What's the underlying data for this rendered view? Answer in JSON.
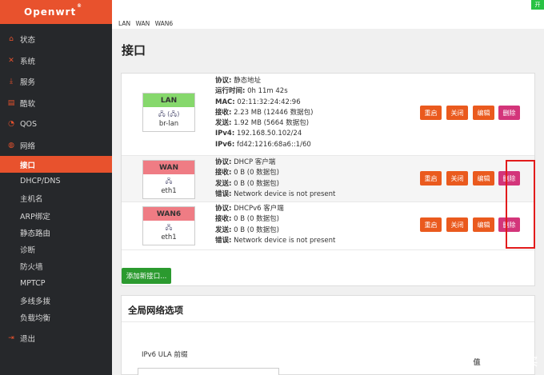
{
  "brand": {
    "name": "Openwrt",
    "reg": "®"
  },
  "topbar": {
    "toggle": "开"
  },
  "breadcrumb": [
    "LAN",
    "WAN",
    "WAN6"
  ],
  "sidebar": {
    "items": [
      {
        "icon": "home-icon",
        "glyph": "⌂",
        "label": "状态"
      },
      {
        "icon": "tools-icon",
        "glyph": "✕",
        "label": "系统"
      },
      {
        "icon": "download-icon",
        "glyph": "⤓",
        "label": "服务"
      },
      {
        "icon": "box-icon",
        "glyph": "▤",
        "label": "酷软"
      },
      {
        "icon": "gauge-icon",
        "glyph": "◔",
        "label": "QOS"
      },
      {
        "icon": "globe-icon",
        "glyph": "◍",
        "label": "网络"
      }
    ],
    "submenu": [
      "接口",
      "DHCP/DNS",
      "主机名",
      "ARP绑定",
      "静态路由",
      "诊断",
      "防火墙",
      "MPTCP",
      "多线多拨",
      "负载均衡"
    ],
    "logout": {
      "icon": "logout-icon",
      "glyph": "⇥",
      "label": "退出"
    }
  },
  "page": {
    "title": "接口"
  },
  "interfaces": [
    {
      "name": "LAN",
      "device": "br-lan",
      "dev_icons": "🖧 (🖧)",
      "info": [
        [
          "协议:",
          "静态地址"
        ],
        [
          "运行时间:",
          "0h 11m 42s"
        ],
        [
          "MAC:",
          "02:11:32:24:42:96"
        ],
        [
          "接收:",
          "2.23 MB (12446 数据包)"
        ],
        [
          "发送:",
          "1.92 MB (5664 数据包)"
        ],
        [
          "IPv4:",
          "192.168.50.102/24"
        ],
        [
          "IPv6:",
          "fd42:1216:68a6::1/60"
        ]
      ]
    },
    {
      "name": "WAN",
      "device": "eth1",
      "dev_icons": "🖧",
      "info": [
        [
          "协议:",
          "DHCP 客户端"
        ],
        [
          "接收:",
          "0 B (0 数据包)"
        ],
        [
          "发送:",
          "0 B (0 数据包)"
        ],
        [
          "错误:",
          "Network device is not present"
        ]
      ]
    },
    {
      "name": "WAN6",
      "device": "eth1",
      "dev_icons": "🖧",
      "info": [
        [
          "协议:",
          "DHCPv6 客户端"
        ],
        [
          "接收:",
          "0 B (0 数据包)"
        ],
        [
          "发送:",
          "0 B (0 数据包)"
        ],
        [
          "错误:",
          "Network device is not present"
        ]
      ]
    }
  ],
  "buttons": {
    "restart": "重启",
    "stop": "关闭",
    "edit": "编辑",
    "delete": "删除"
  },
  "add_button": "添加新接口...",
  "global": {
    "title": "全局网络选项",
    "ula_label": "IPv6 ULA 前缀"
  },
  "watermark": "什么值得买",
  "colors": {
    "accent": "#e8522d",
    "lan": "#86d86c",
    "wan": "#ef7c84",
    "highlight": "#e21b1b"
  }
}
